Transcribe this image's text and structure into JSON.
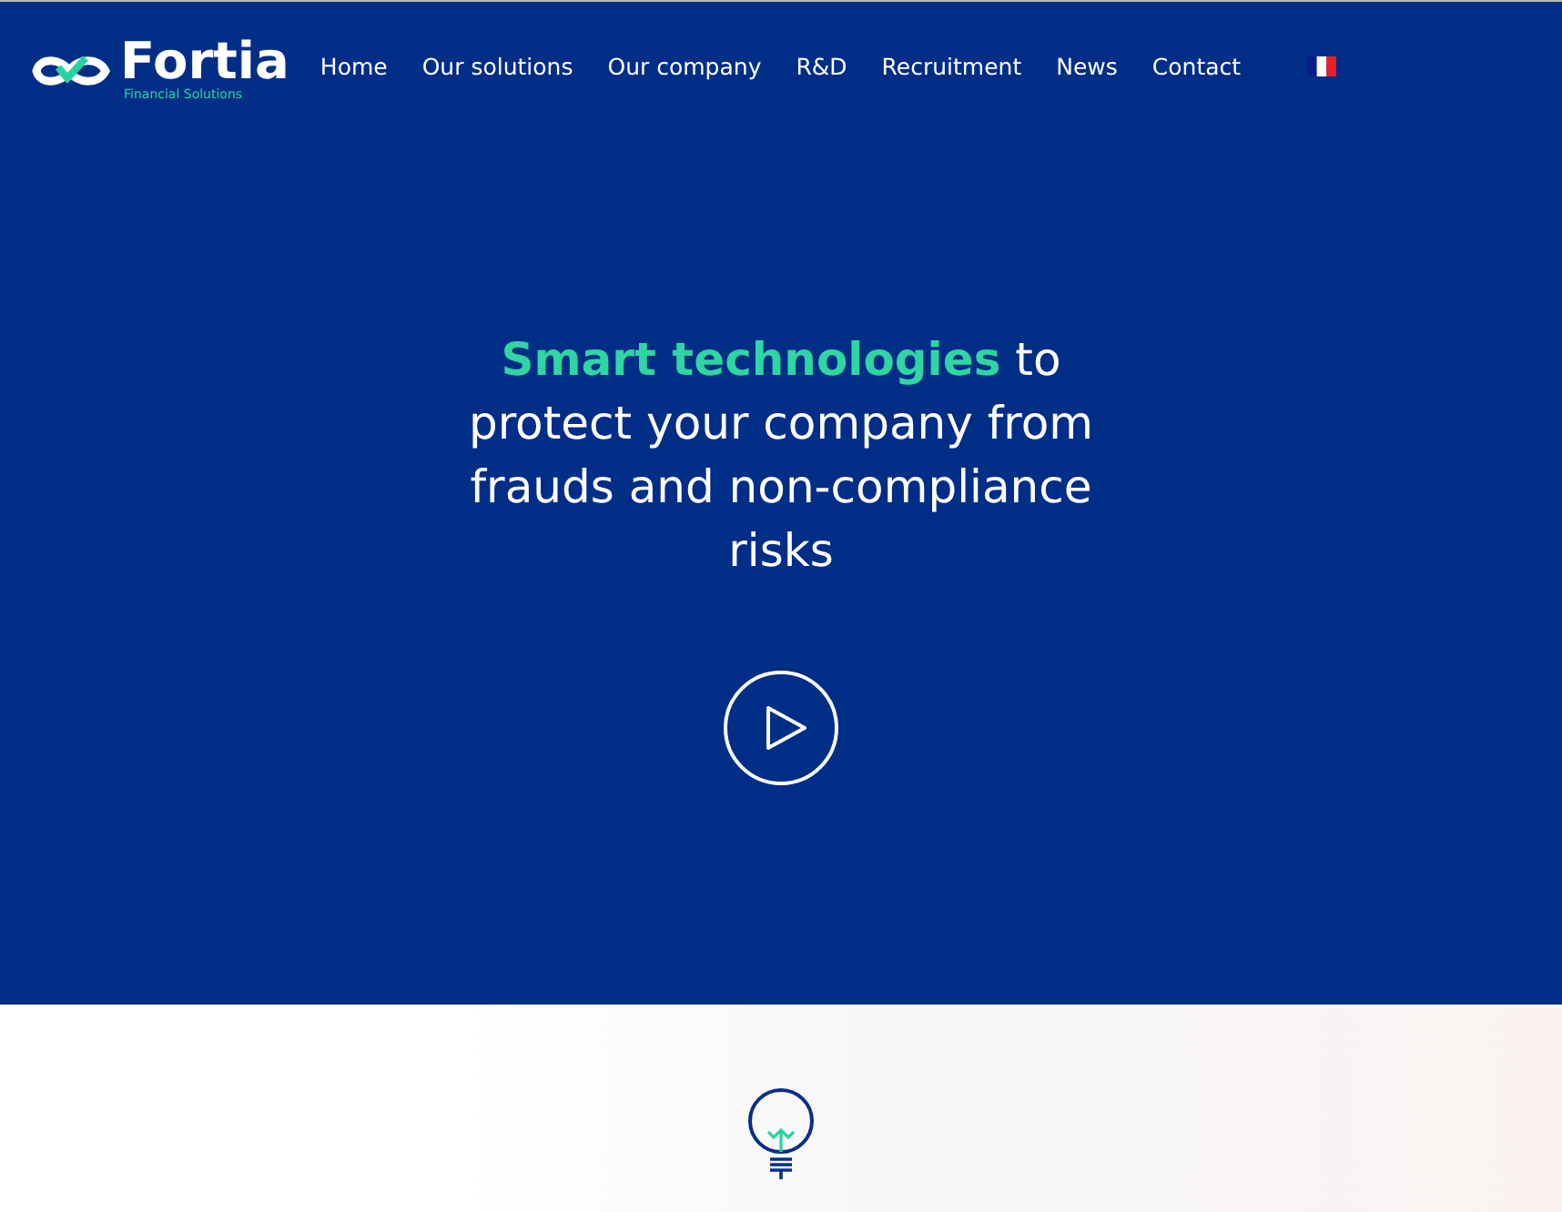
{
  "logo": {
    "name": "Fortia",
    "tagline": "Financial Solutions"
  },
  "nav": [
    {
      "label": "Home"
    },
    {
      "label": "Our solutions"
    },
    {
      "label": "Our company"
    },
    {
      "label": "R&D"
    },
    {
      "label": "Recruitment"
    },
    {
      "label": "News"
    },
    {
      "label": "Contact"
    }
  ],
  "hero": {
    "headline": "**Smart technologies** to protect your company from frauds and non-compliance risks"
  }
}
